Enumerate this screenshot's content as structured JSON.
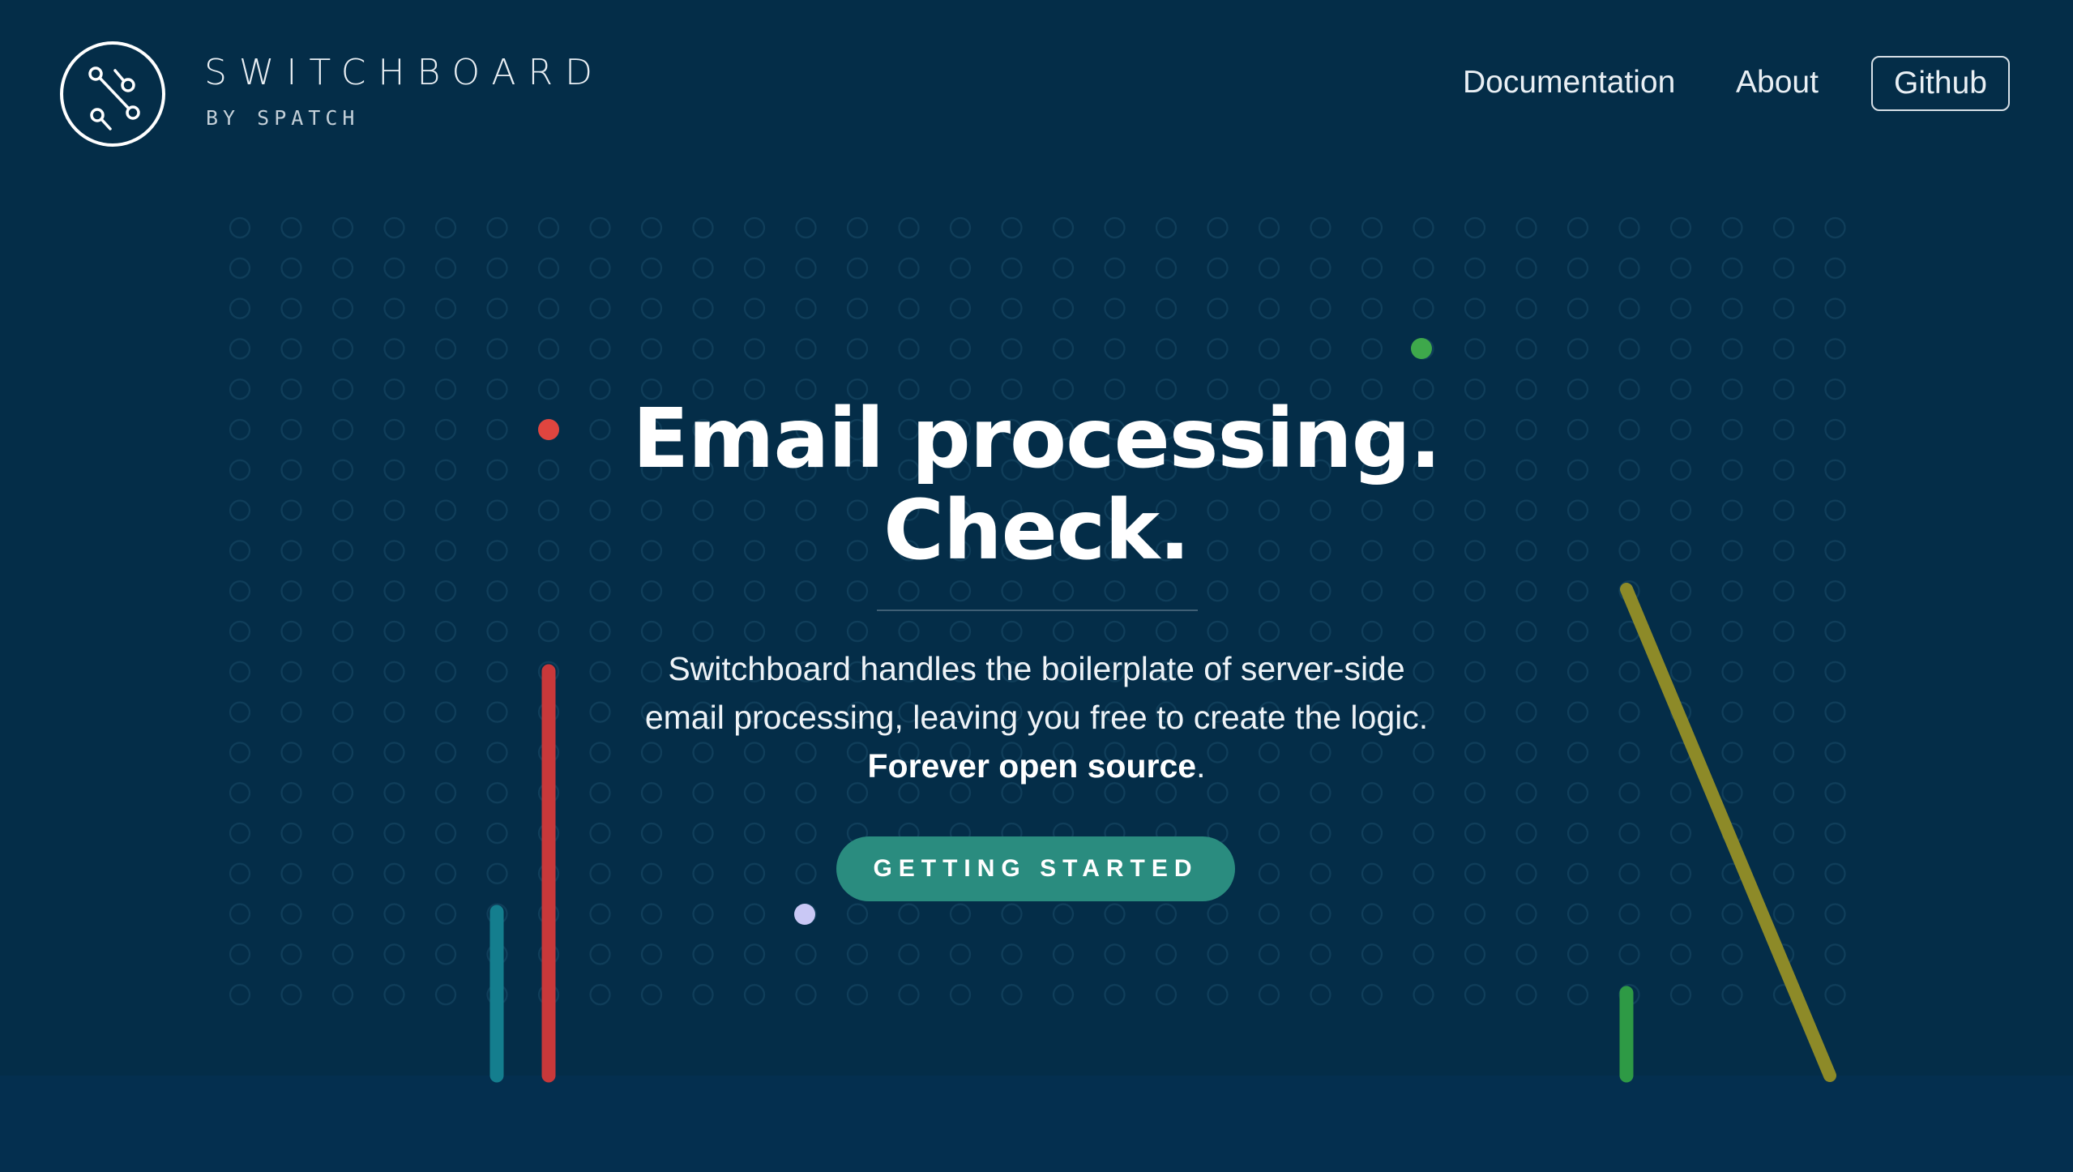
{
  "header": {
    "brand": {
      "name": "SWITCHBOARD",
      "subtitle": "BY SPATCH",
      "logo_icon": "switchboard-circuit-logo-icon"
    },
    "nav": {
      "documentation": "Documentation",
      "about": "About",
      "github": "Github"
    }
  },
  "hero": {
    "title_line1": "Email processing.",
    "title_line2": "Check.",
    "description_line1": "Switchboard handles the boilerplate of server-side",
    "description_line2": "email processing, leaving you free to create the logic.",
    "description_bold": "Forever open source",
    "description_end": ".",
    "cta_label": "GETTING STARTED"
  },
  "colors": {
    "background": "#042d48",
    "accent_teal": "#2a8c7f",
    "dot_red": "#e0453f",
    "dot_green": "#3ea84b",
    "dot_lavender": "#c9c8f5",
    "line_red": "#c8383a",
    "line_teal": "#147e8e",
    "line_olive": "#8d8a28",
    "line_green": "#2e9a45"
  }
}
